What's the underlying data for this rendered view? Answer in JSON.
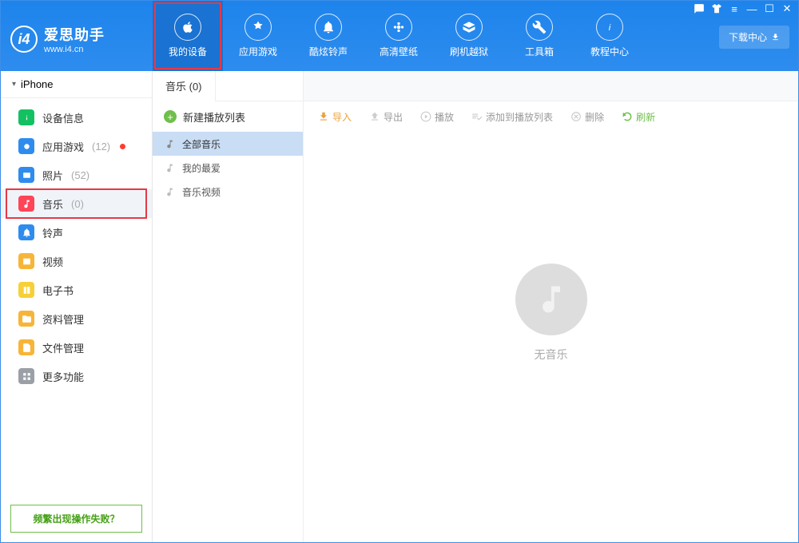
{
  "brand": {
    "title": "爱思助手",
    "subtitle": "www.i4.cn",
    "logo_text": "i4"
  },
  "header_nav": [
    {
      "id": "my-device",
      "label": "我的设备"
    },
    {
      "id": "app-games",
      "label": "应用游戏"
    },
    {
      "id": "ringtones",
      "label": "酷炫铃声"
    },
    {
      "id": "wallpapers",
      "label": "高清壁纸"
    },
    {
      "id": "flash-jailbreak",
      "label": "刷机越狱"
    },
    {
      "id": "toolbox",
      "label": "工具箱"
    },
    {
      "id": "tutorials",
      "label": "教程中心"
    }
  ],
  "download_center": "下载中心",
  "device_name": "iPhone",
  "sidebar": {
    "items": [
      {
        "id": "device-info",
        "label": "设备信息",
        "color": "#14c162"
      },
      {
        "id": "apps",
        "label": "应用游戏",
        "count": "(12)",
        "has_dot": true,
        "color": "#2e8cee"
      },
      {
        "id": "photos",
        "label": "照片",
        "count": "(52)",
        "color": "#2e8cee"
      },
      {
        "id": "music",
        "label": "音乐",
        "count": "(0)",
        "color": "#ff4557"
      },
      {
        "id": "ringtones",
        "label": "铃声",
        "color": "#2e8cee"
      },
      {
        "id": "videos",
        "label": "视频",
        "color": "#f7b538"
      },
      {
        "id": "ebooks",
        "label": "电子书",
        "color": "#f7b538"
      },
      {
        "id": "data-mgmt",
        "label": "资料管理",
        "color": "#f7b538"
      },
      {
        "id": "file-mgmt",
        "label": "文件管理",
        "color": "#f7b538"
      },
      {
        "id": "more",
        "label": "更多功能",
        "color": "#9aa0a6"
      }
    ]
  },
  "help_link": "频繁出现操作失败？",
  "music_panel": {
    "tab_label": "音乐 (0)",
    "new_playlist": "新建播放列表",
    "categories": [
      {
        "id": "all",
        "label": "全部音乐"
      },
      {
        "id": "favorites",
        "label": "我的最爱"
      },
      {
        "id": "music-video",
        "label": "音乐视频"
      }
    ]
  },
  "actions": {
    "import": "导入",
    "export": "导出",
    "play": "播放",
    "add_to_playlist": "添加到播放列表",
    "delete": "删除",
    "refresh": "刷新"
  },
  "empty_state": "无音乐"
}
